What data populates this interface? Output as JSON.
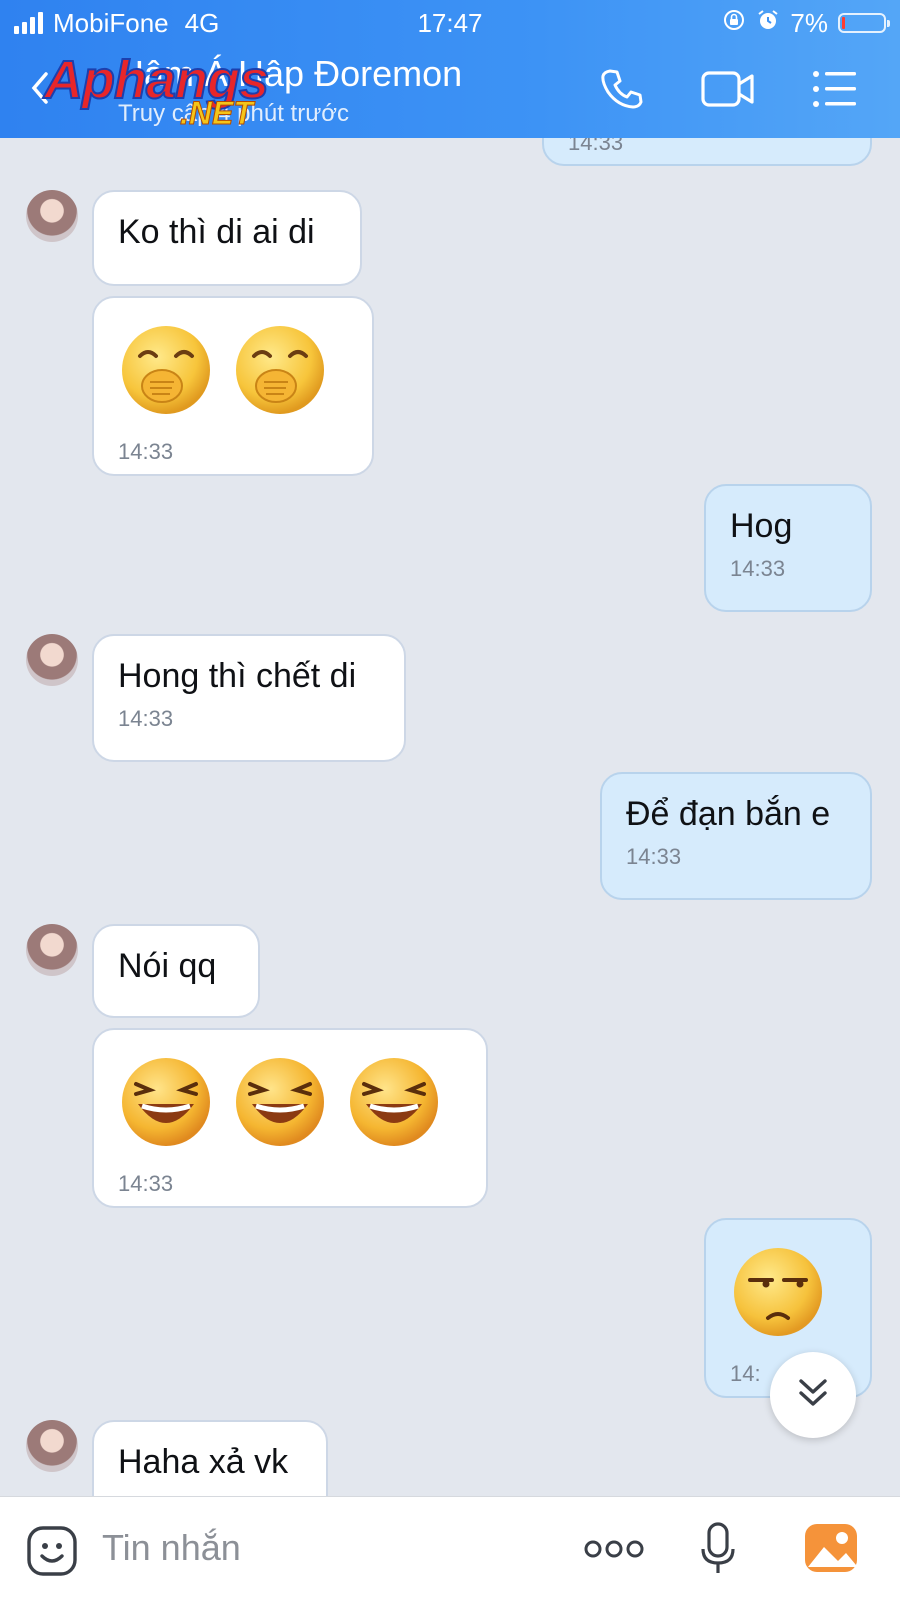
{
  "status_bar": {
    "carrier": "MobiFone",
    "network": "4G",
    "time": "17:47",
    "battery": "7%",
    "battery_level": 0.07
  },
  "header": {
    "back_icon": "chevron-left-icon",
    "title": "Hâm Á Hâp Đoremon",
    "subtitle": "Truy cập 4 phút trước",
    "watermark_main": "Aphangs",
    "watermark_suffix": ".NET",
    "actions": [
      "phone-icon",
      "video-call-icon",
      "menu-list-icon"
    ]
  },
  "messages": [
    {
      "side": "out",
      "partial": true,
      "time": "14:33"
    },
    {
      "side": "in",
      "text": "Ko thì di ai di"
    },
    {
      "side": "in",
      "emoji": [
        "🤭",
        "🤭"
      ],
      "time": "14:33"
    },
    {
      "side": "out",
      "text": "Hog",
      "time": "14:33"
    },
    {
      "side": "in",
      "text": "Hong thì chết di",
      "time": "14:33"
    },
    {
      "side": "out",
      "text": "Để đạn bắn e",
      "time": "14:33"
    },
    {
      "side": "in",
      "text": "Nói qq"
    },
    {
      "side": "in",
      "emoji": [
        "😆",
        "😆",
        "😆"
      ],
      "time": "14:33"
    },
    {
      "side": "out",
      "emoji": [
        "😒"
      ],
      "time": "14:"
    },
    {
      "side": "in",
      "text": "Haha xả vk",
      "partial": true
    }
  ],
  "input": {
    "placeholder": "Tin nhắn",
    "icons": [
      "sticker-icon",
      "more-icon",
      "microphone-icon",
      "image-icon"
    ]
  },
  "colors": {
    "header": "#3d93f5",
    "chat_background": "#e3e7ee",
    "incoming_bubble": "#ffffff",
    "outgoing_bubble": "#d6ebfc"
  }
}
